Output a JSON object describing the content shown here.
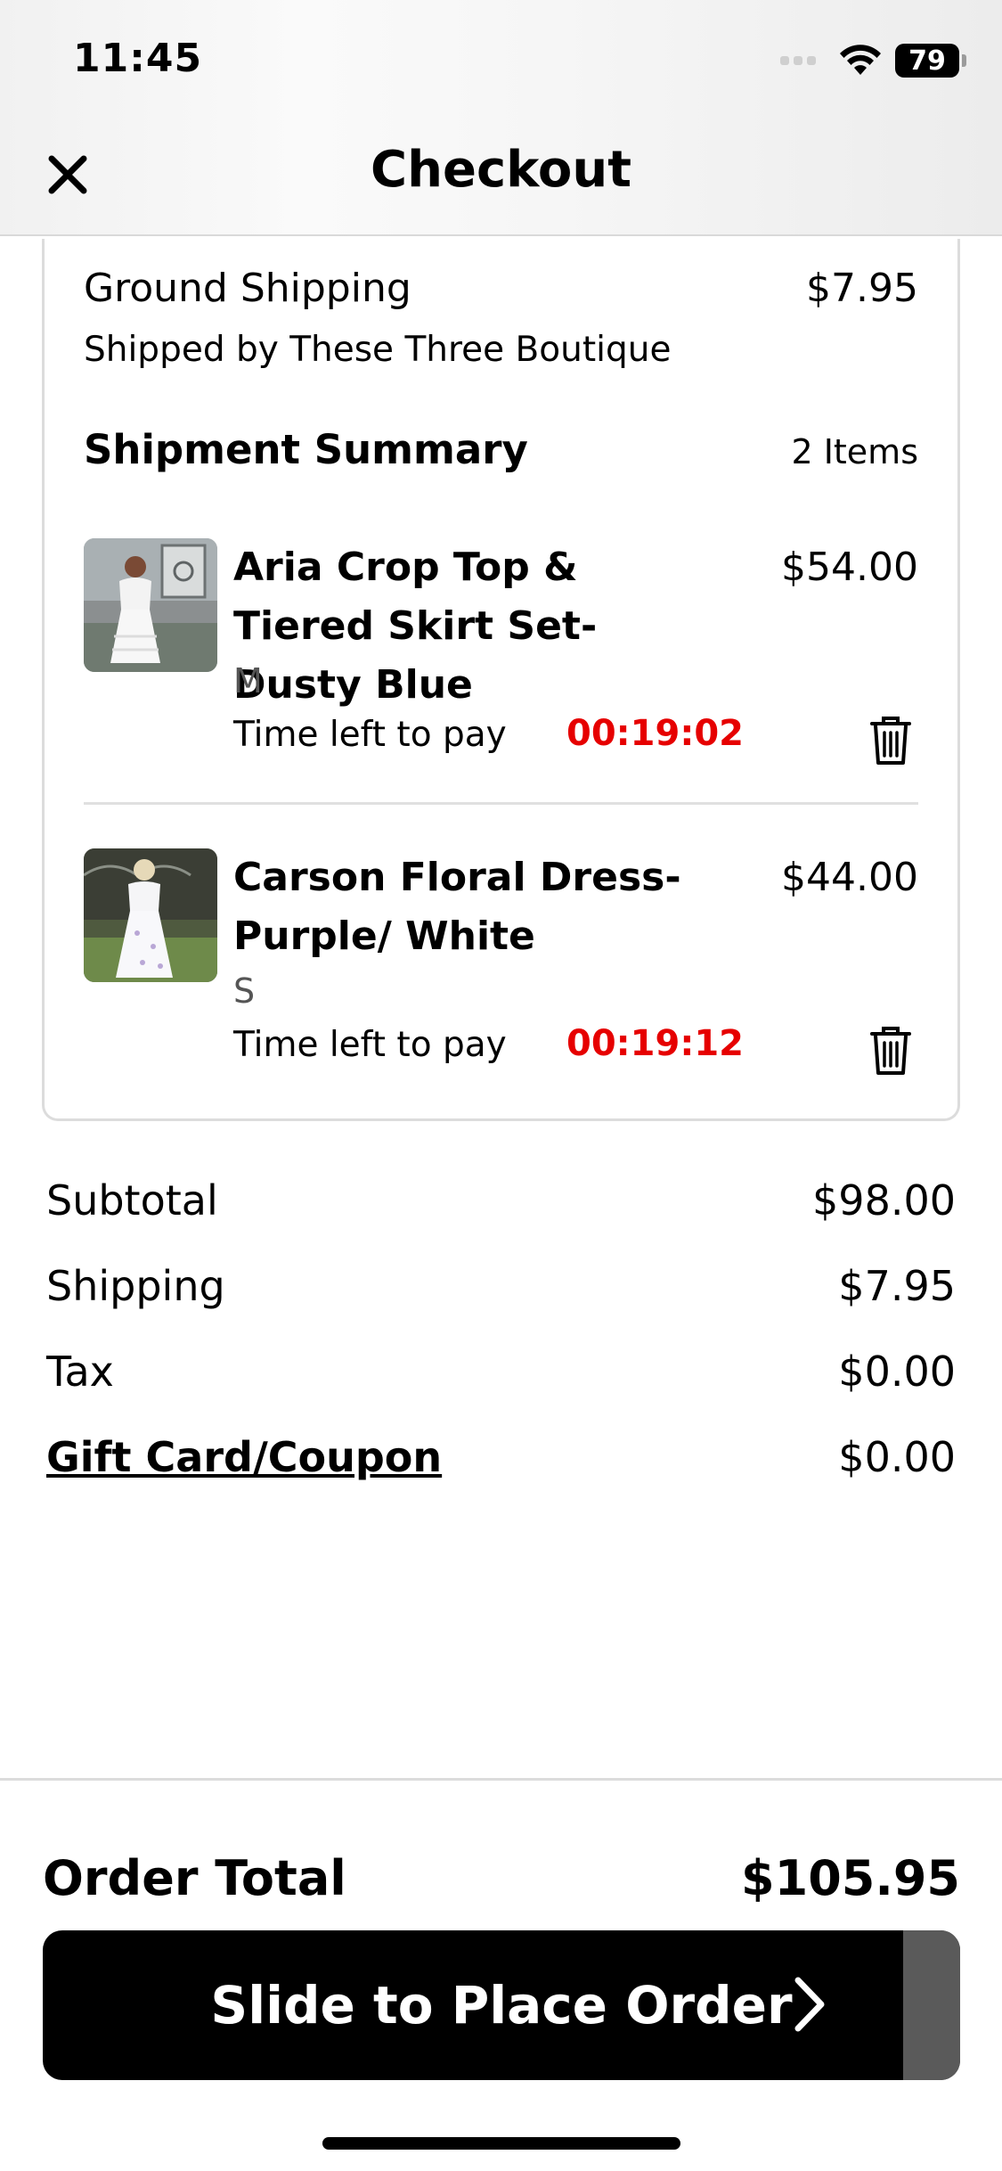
{
  "status_bar": {
    "time": "11:45",
    "battery": "79"
  },
  "header": {
    "title": "Checkout",
    "close_icon": "close-icon"
  },
  "shipment": {
    "method": "Ground Shipping",
    "method_price": "$7.95",
    "shipped_by": "Shipped by These Three Boutique",
    "summary_title": "Shipment Summary",
    "item_count": "2 Items",
    "items": [
      {
        "name": "Aria Crop Top & Tiered Skirt Set- Dusty Blue",
        "price": "$54.00",
        "size": "M",
        "timer_label": "Time left to pay",
        "timer": "00:19:02"
      },
      {
        "name": "Carson Floral Dress- Purple/ White",
        "price": "$44.00",
        "size": "S",
        "timer_label": "Time left to pay",
        "timer": "00:19:12"
      }
    ]
  },
  "totals": {
    "subtotal_label": "Subtotal",
    "subtotal": "$98.00",
    "shipping_label": "Shipping",
    "shipping": "$7.95",
    "tax_label": "Tax",
    "tax": "$0.00",
    "coupon_label": "Gift Card/Coupon",
    "coupon": "$0.00"
  },
  "footer": {
    "order_total_label": "Order Total",
    "order_total": "$105.95",
    "slide_label": "Slide to Place Order"
  },
  "colors": {
    "timer": "#e60000",
    "button": "#000000",
    "handle": "#5a5a5a"
  }
}
